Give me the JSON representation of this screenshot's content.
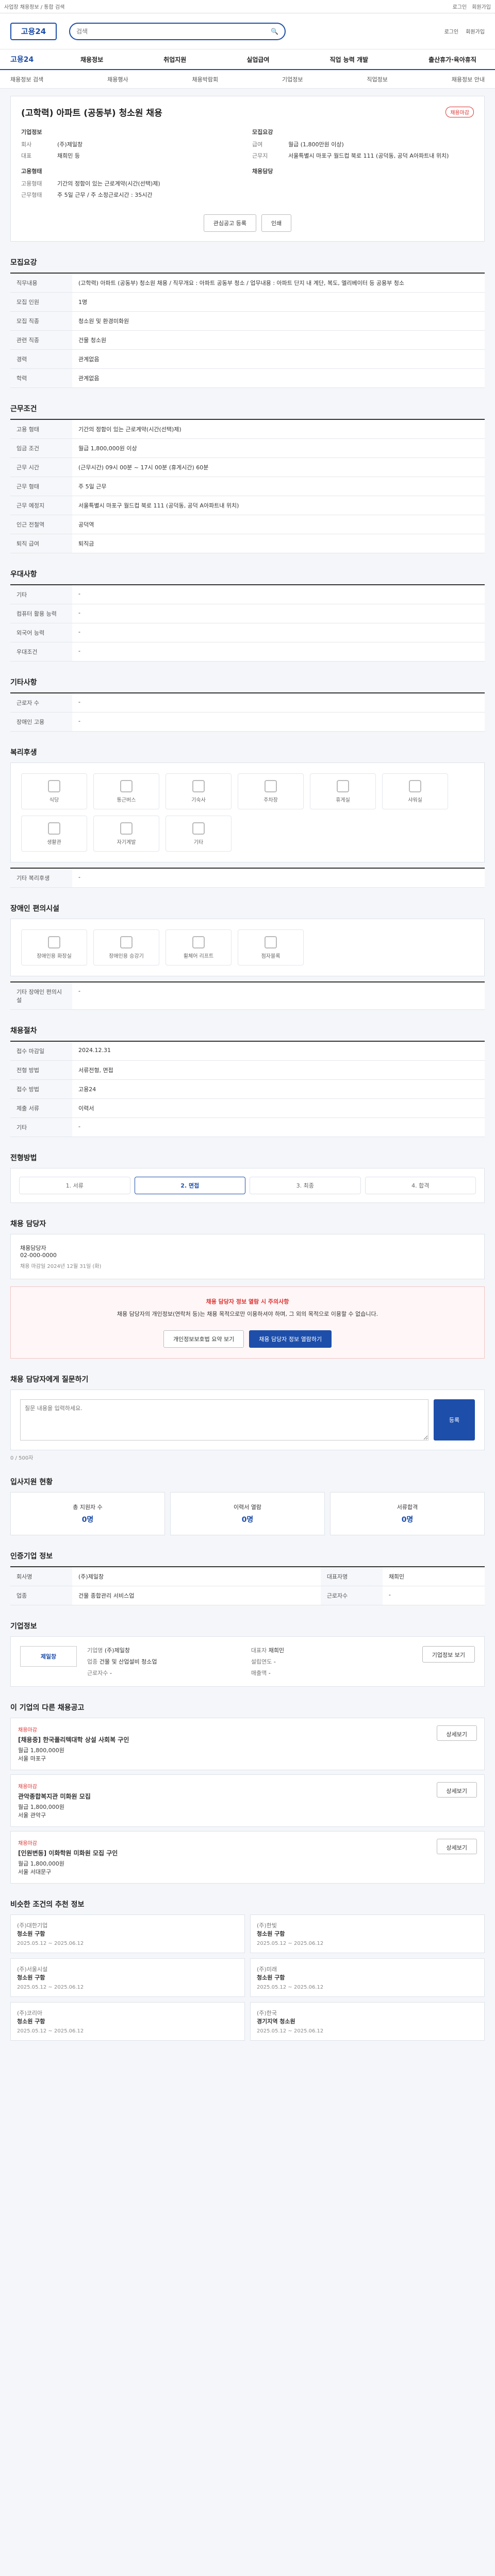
{
  "topbar": {
    "left": "사업장 채용정보 / 통합 검색",
    "links": [
      "로그인",
      "회원가입"
    ]
  },
  "header": {
    "logo": "고용24",
    "search_placeholder": "검색",
    "util": [
      "로그인",
      "회원가입"
    ]
  },
  "gnb": {
    "logo": "고용24",
    "menu": [
      "채용정보",
      "취업지원",
      "실업급여",
      "직업 능력 개발",
      "출산휴가·육아휴직"
    ]
  },
  "sub": {
    "items": [
      "채용정보 검색",
      "채용행사",
      "채용박람회",
      "기업정보",
      "직업정보",
      "채용정보 안내"
    ]
  },
  "job": {
    "title": "(고학력) 아파트 (공동부) 청소원 채용",
    "badge": "채용마감",
    "company_label": "기업정보",
    "company": [
      [
        "회사",
        "(주)제일창"
      ],
      [
        "대표",
        "채희민 등"
      ]
    ],
    "cond_label": "모집요강",
    "cond": [
      [
        "급여",
        "월급 (1,800만원 이상)"
      ],
      [
        "근무지",
        "서울특별시 마포구 월드컵 북로 111 (공덕동, 공덕 A아파트내 위치)"
      ]
    ],
    "worker_label": "고용형태",
    "worker": [
      [
        "고용형태",
        "기간의 정함이 있는 근로계약(시간(선택)제)"
      ],
      [
        "근무형태",
        "주 5일 근무 / 주 소정근로시간 : 35시간"
      ]
    ],
    "manager_label": "채용담당",
    "btn_apply": "관심공고 등록",
    "btn_print": "인쇄"
  },
  "recruit": {
    "title": "모집요강",
    "rows": [
      [
        "직무내용",
        "(고학력) 아파트 (공동부) 청소원 채용 / 직무개요 : 아파트 공동부 청소 / 업무내용 : 아파트 단지 내 계단, 복도, 엘리베이터 등 공용부 청소"
      ],
      [
        "모집 인원",
        "1명"
      ],
      [
        "모집 직종",
        "청소원 및 환경미화원"
      ],
      [
        "관련 직종",
        "건물 청소원"
      ],
      [
        "경력",
        "관계없음"
      ],
      [
        "학력",
        "관계없음"
      ]
    ]
  },
  "work": {
    "title": "근무조건",
    "rows": [
      [
        "고용 형태",
        "기간의 정함이 있는 근로계약(시간(선택)제)"
      ],
      [
        "임금 조건",
        "월급 1,800,000원 이상"
      ],
      [
        "근무 시간",
        "(근무시간) 09시 00분 ~ 17시 00분 (휴게시간) 60분"
      ],
      [
        "근무 형태",
        "주 5일 근무"
      ],
      [
        "근무 예정지",
        "서울특별시 마포구 월드컵 북로 111 (공덕동, 공덕 A아파트내 위치)"
      ],
      [
        "인근 전철역",
        "공덕역"
      ],
      [
        "퇴직 급여",
        "퇴직금"
      ]
    ]
  },
  "welfare": {
    "title": "우대사항",
    "rows": [
      [
        "기타",
        "-"
      ],
      [
        "컴퓨터 활용 능력",
        "-"
      ],
      [
        "외국어 능력",
        "-"
      ],
      [
        "우대조건",
        "-"
      ]
    ]
  },
  "other": {
    "title": "기타사항",
    "rows": [
      [
        "근로자 수",
        "-"
      ],
      [
        "장애인 고용",
        "-"
      ]
    ]
  },
  "facility": {
    "title": "복리후생",
    "items": [
      "식당",
      "통근버스",
      "기숙사",
      "주차장",
      "휴게실",
      "샤워실",
      "생활관",
      "자기계발",
      "기타"
    ],
    "etc_label": "기타 복리후생",
    "etc": "-"
  },
  "disabled": {
    "title": "장애인 편의시설",
    "items": [
      "장애인용 화장실",
      "장애인용 승강기",
      "휠체어 리프트",
      "점자블록"
    ],
    "etc_label": "기타 장애인 편의시설",
    "etc": "-"
  },
  "apply": {
    "title": "채용절차",
    "rows": [
      [
        "접수 마감일",
        "2024.12.31"
      ],
      [
        "전형 방법",
        "서류전형, 면접"
      ],
      [
        "접수 방법",
        "고용24"
      ],
      [
        "제출 서류",
        "이력서"
      ],
      [
        "기타",
        "-"
      ]
    ]
  },
  "steps": {
    "title": "전형방법",
    "items": [
      "1. 서류",
      "2. 면접",
      "3. 최종",
      "4. 합격"
    ],
    "active": 1
  },
  "contact": {
    "title": "채용 담당자",
    "name": "채용담당자",
    "phone": "02-000-0000",
    "desc": "채용 마감일 2024년 12월 31일 (화)"
  },
  "warn": {
    "title": "채용 담당자 정보 열람 시 주의사항",
    "text": "채용 담당자의 개인정보(연락처 등)는 채용 목적으로만 이용하셔야 하며, 그 외의 목적으로 이용할 수 없습니다.",
    "btn1": "개인정보보호법 요약 보기",
    "btn2": "채용 담당자 정보 열람하기"
  },
  "qna": {
    "title": "채용 담당자에게 질문하기",
    "placeholder": "질문 내용을 입력하세요.",
    "count": "0 / 500자",
    "btn": "등록"
  },
  "status": {
    "title": "입사지원 현황",
    "total": "지원자 0명",
    "boxes": [
      [
        "총 지원자 수",
        "0명"
      ],
      [
        "이력서 열람",
        "0명"
      ],
      [
        "서류합격",
        "0명"
      ]
    ]
  },
  "gen": {
    "title": "인증기업 정보",
    "rows": [
      [
        "회사명",
        "(주)제일창"
      ],
      [
        "대표자명",
        "채희민"
      ],
      [
        "업종",
        "건물 종합관리 서비스업"
      ],
      [
        "근로자수",
        "-"
      ]
    ]
  },
  "corp": {
    "title": "기업정보",
    "logo": "제일창",
    "rows": [
      [
        "기업명",
        "(주)제일창"
      ],
      [
        "대표자",
        "채희민"
      ],
      [
        "업종",
        "건물 및 산업설비 청소업"
      ],
      [
        "설립연도",
        "-"
      ],
      [
        "근로자수",
        "-"
      ],
      [
        "매출액",
        "-"
      ]
    ],
    "btn": "기업정보 보기"
  },
  "others": {
    "title": "이 기업의 다른 채용공고",
    "items": [
      {
        "tag": "채용마감",
        "title": "[채용중] 한국폴리텍대학 상설 사회복 구인",
        "pay": "월급 1,800,000원",
        "loc": "서울 마포구",
        "btn": "상세보기"
      },
      {
        "tag": "채용마감",
        "title": "관악종합복지관 미화원 모집",
        "pay": "월급 1,800,000원",
        "loc": "서울 관악구",
        "btn": "상세보기"
      },
      {
        "tag": "채용마감",
        "title": "[인원변동] 이화학원 미화원 모집 구인",
        "pay": "월급 1,800,000원",
        "loc": "서울 서대문구",
        "btn": "상세보기"
      }
    ]
  },
  "similar": {
    "title": "비슷한 조건의 추천 정보",
    "items": [
      {
        "company": "(주)대한기업",
        "title": "청소원 구함",
        "date": "2025.05.12 ~ 2025.06.12"
      },
      {
        "company": "(주)한빛",
        "title": "청소원 구함",
        "date": "2025.05.12 ~ 2025.06.12"
      },
      {
        "company": "(주)서울시설",
        "title": "청소원 구함",
        "date": "2025.05.12 ~ 2025.06.12"
      },
      {
        "company": "(주)미래",
        "title": "청소원 구함",
        "date": "2025.05.12 ~ 2025.06.12"
      },
      {
        "company": "(주)코리아",
        "title": "청소원 구함",
        "date": "2025.05.12 ~ 2025.06.12"
      },
      {
        "company": "(주)한국",
        "title": "경기지역 청소원",
        "date": "2025.05.12 ~ 2025.06.12"
      }
    ]
  }
}
